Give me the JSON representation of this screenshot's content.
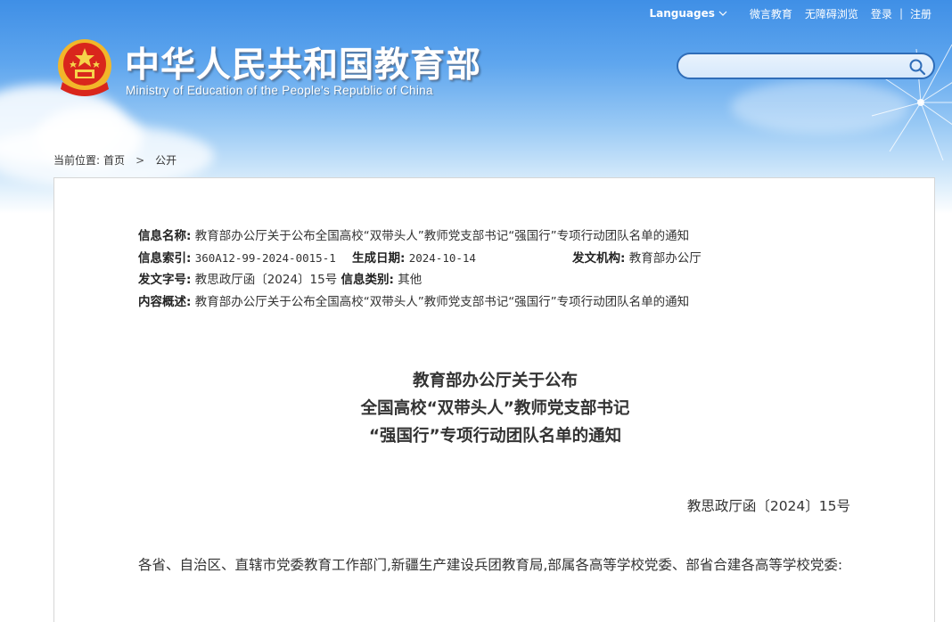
{
  "topbar": {
    "languages": "Languages",
    "weibo": "微言教育",
    "accessibility": "无障碍浏览",
    "login": "登录",
    "register": "注册"
  },
  "header": {
    "title": "中华人民共和国教育部",
    "subtitle": "Ministry of Education of the People's Republic of China"
  },
  "search": {
    "value": ""
  },
  "breadcrumb": {
    "prefix": "当前位置:",
    "home": "首页",
    "current": "公开"
  },
  "meta": {
    "name_label": "信息名称:",
    "name_value": "教育部办公厅关于公布全国高校“双带头人”教师党支部书记“强国行”专项行动团队名单的通知",
    "index_label": "信息索引:",
    "index_value": "360A12-99-2024-0015-1",
    "date_label": "生成日期:",
    "date_value": "2024-10-14",
    "issuer_label": "发文机构:",
    "issuer_value": "教育部办公厅",
    "docno_label": "发文字号:",
    "docno_value": "教思政厅函〔2024〕15号",
    "category_label": "信息类别:",
    "category_value": "其他",
    "summary_label": "内容概述:",
    "summary_value": "教育部办公厅关于公布全国高校“双带头人”教师党支部书记“强国行”专项行动团队名单的通知"
  },
  "document": {
    "title_line1": "教育部办公厅关于公布",
    "title_line2": "全国高校“双带头人”教师党支部书记",
    "title_line3": "“强国行”专项行动团队名单的通知",
    "doc_number": "教思政厅函〔2024〕15号",
    "body": "各省、自治区、直辖市党委教育工作部门,新疆生产建设兵团教育局,部属各高等学校党委、部省合建各高等学校党委:"
  },
  "colors": {
    "sky_top": "#3f8fe6",
    "search_border": "#2f6db8",
    "text": "#333333"
  }
}
